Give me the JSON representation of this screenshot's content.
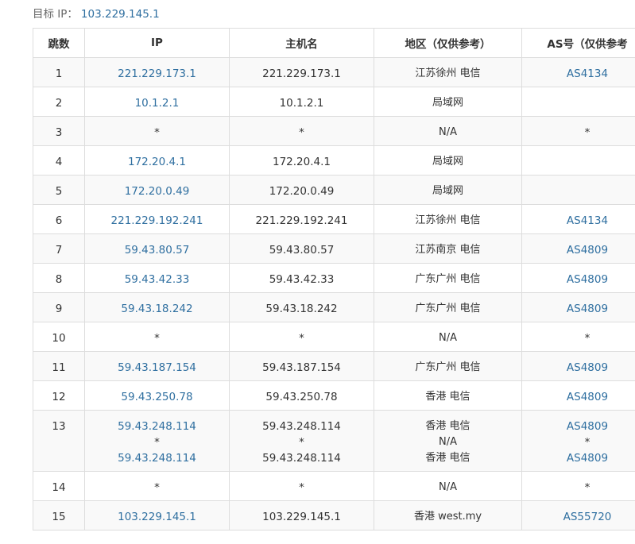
{
  "target": {
    "label": "目标 IP：",
    "ip": "103.229.145.1"
  },
  "colors": {
    "link": "#2f6fa0",
    "border": "#dddddd",
    "stripe": "#f9f9f9"
  },
  "table": {
    "headers": {
      "hop": "跳数",
      "ip": "IP",
      "host": "主机名",
      "region": "地区（仅供参考）",
      "as": "AS号（仅供参考"
    },
    "rows": [
      {
        "hop": "1",
        "ip": [
          "221.229.173.1"
        ],
        "host": [
          "221.229.173.1"
        ],
        "region": [
          "江苏徐州 电信"
        ],
        "as": [
          "AS4134"
        ]
      },
      {
        "hop": "2",
        "ip": [
          "10.1.2.1"
        ],
        "host": [
          "10.1.2.1"
        ],
        "region": [
          "局域网"
        ],
        "as": [
          ""
        ]
      },
      {
        "hop": "3",
        "ip": [
          "*"
        ],
        "host": [
          "*"
        ],
        "region": [
          "N/A"
        ],
        "as": [
          "*"
        ]
      },
      {
        "hop": "4",
        "ip": [
          "172.20.4.1"
        ],
        "host": [
          "172.20.4.1"
        ],
        "region": [
          "局域网"
        ],
        "as": [
          ""
        ]
      },
      {
        "hop": "5",
        "ip": [
          "172.20.0.49"
        ],
        "host": [
          "172.20.0.49"
        ],
        "region": [
          "局域网"
        ],
        "as": [
          ""
        ]
      },
      {
        "hop": "6",
        "ip": [
          "221.229.192.241"
        ],
        "host": [
          "221.229.192.241"
        ],
        "region": [
          "江苏徐州 电信"
        ],
        "as": [
          "AS4134"
        ]
      },
      {
        "hop": "7",
        "ip": [
          "59.43.80.57"
        ],
        "host": [
          "59.43.80.57"
        ],
        "region": [
          "江苏南京 电信"
        ],
        "as": [
          "AS4809"
        ]
      },
      {
        "hop": "8",
        "ip": [
          "59.43.42.33"
        ],
        "host": [
          "59.43.42.33"
        ],
        "region": [
          "广东广州 电信"
        ],
        "as": [
          "AS4809"
        ]
      },
      {
        "hop": "9",
        "ip": [
          "59.43.18.242"
        ],
        "host": [
          "59.43.18.242"
        ],
        "region": [
          "广东广州 电信"
        ],
        "as": [
          "AS4809"
        ]
      },
      {
        "hop": "10",
        "ip": [
          "*"
        ],
        "host": [
          "*"
        ],
        "region": [
          "N/A"
        ],
        "as": [
          "*"
        ]
      },
      {
        "hop": "11",
        "ip": [
          "59.43.187.154"
        ],
        "host": [
          "59.43.187.154"
        ],
        "region": [
          "广东广州 电信"
        ],
        "as": [
          "AS4809"
        ]
      },
      {
        "hop": "12",
        "ip": [
          "59.43.250.78"
        ],
        "host": [
          "59.43.250.78"
        ],
        "region": [
          "香港 电信"
        ],
        "as": [
          "AS4809"
        ]
      },
      {
        "hop": "13",
        "ip": [
          "59.43.248.114",
          "*",
          "59.43.248.114"
        ],
        "host": [
          "59.43.248.114",
          "*",
          "59.43.248.114"
        ],
        "region": [
          "香港 电信",
          "N/A",
          "香港 电信"
        ],
        "as": [
          "AS4809",
          "*",
          "AS4809"
        ]
      },
      {
        "hop": "14",
        "ip": [
          "*"
        ],
        "host": [
          "*"
        ],
        "region": [
          "N/A"
        ],
        "as": [
          "*"
        ]
      },
      {
        "hop": "15",
        "ip": [
          "103.229.145.1"
        ],
        "host": [
          "103.229.145.1"
        ],
        "region": [
          "香港 west.my"
        ],
        "as": [
          "AS55720"
        ]
      }
    ]
  }
}
